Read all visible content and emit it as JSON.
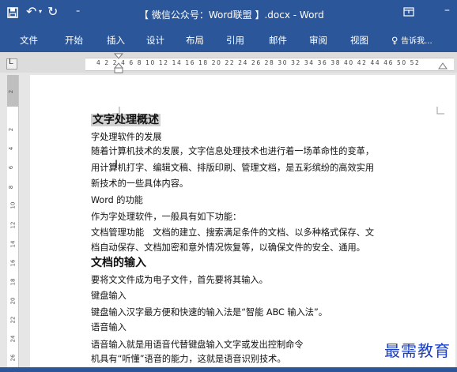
{
  "window": {
    "title": "【 微信公众号：Word联盟 】.docx - Word",
    "save_icon": "💾",
    "undo_icon": "↶",
    "redo_icon": "↻",
    "customize_icon": "▾",
    "ribbon_display_icon": "▣"
  },
  "ribbon": {
    "tabs": [
      "文件",
      "开始",
      "插入",
      "设计",
      "布局",
      "引用",
      "邮件",
      "审阅",
      "视图"
    ],
    "tell_me": "告诉我..."
  },
  "ruler": {
    "numbers": "4  2    2  4  6  8 10 12 14 16 18 20 22 24 26 28 30 32 34 36 38 40 42 44 46  50 52",
    "vertical": [
      "2",
      "2",
      "4",
      "6",
      "8",
      "10",
      "12",
      "14",
      "16",
      "18",
      "20",
      "22",
      "24",
      "26"
    ]
  },
  "document": {
    "lines": [
      {
        "text": "文字处理概述",
        "style": "heading-selected"
      },
      {
        "text": "字处理软件的发展",
        "style": "normal"
      },
      {
        "text": "随着计算机技术的发展，文字信息处理技术也进行着一场革命性的变革，",
        "style": "normal"
      },
      {
        "text": "用计算机打字、编辑文稿、排版印刷、管理文档，是五彩缤纷的高效实用",
        "style": "normal"
      },
      {
        "text": "新技术的一些具体内容。",
        "style": "normal"
      },
      {
        "text": "Word 的功能",
        "style": "normal"
      },
      {
        "text": "作为字处理软件，一般具有如下功能：",
        "style": "normal"
      },
      {
        "text": "文档管理功能　文档的建立、搜索满足条件的文档、以多种格式保存、文",
        "style": "normal"
      },
      {
        "text": "档自动保存、文档加密和意外情况恢复等，以确保文件的安全、通用。",
        "style": "normal"
      },
      {
        "text": "文档的输入",
        "style": "heading"
      },
      {
        "text": "要将文文件成为电子文件，首先要将其输入。",
        "style": "normal"
      },
      {
        "text": "键盘输入",
        "style": "normal"
      },
      {
        "text": "键盘输入汉字最方便和快速的输入法是“智能 ABC 输入法”。",
        "style": "normal"
      },
      {
        "text": "语音输入",
        "style": "normal"
      },
      {
        "text": "语音输入就是用语音代替键盘输入文字或发出控制命令",
        "style": "normal"
      },
      {
        "text": "机具有“听懂”语音的能力，这就是语音识别技术。",
        "style": "normal"
      }
    ],
    "cursor": "I"
  },
  "watermark": "最需教育",
  "colors": {
    "ribbon": "#2b579a",
    "selection": "#d0d0d0",
    "watermark": "#1b3fbd"
  }
}
